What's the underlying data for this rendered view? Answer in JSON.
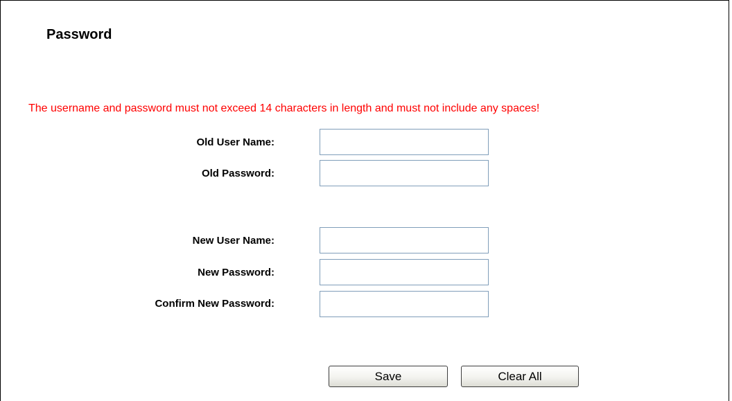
{
  "page": {
    "title": "Password",
    "warning": "The username and password must not exceed 14 characters in length and must not include any spaces!"
  },
  "form": {
    "old_user_name": {
      "label": "Old User Name:",
      "value": ""
    },
    "old_password": {
      "label": "Old Password:",
      "value": ""
    },
    "new_user_name": {
      "label": "New User Name:",
      "value": ""
    },
    "new_password": {
      "label": "New Password:",
      "value": ""
    },
    "confirm_new_password": {
      "label": "Confirm New Password:",
      "value": ""
    }
  },
  "buttons": {
    "save": "Save",
    "clear_all": "Clear All"
  },
  "colors": {
    "warning": "#ff0000",
    "input_border": "#7f9db9"
  }
}
